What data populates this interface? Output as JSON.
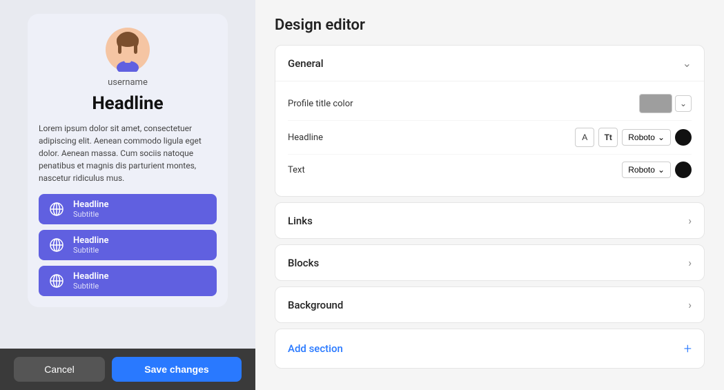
{
  "leftPanel": {
    "username": "username",
    "headline": "Headline",
    "bodyText": "Lorem ipsum dolor sit amet, consectetuer adipiscing elit. Aenean commodo ligula eget dolor. Aenean massa. Cum sociis natoque penatibus et magnis dis parturient montes, nascetur ridiculus mus.",
    "links": [
      {
        "title": "Headline",
        "subtitle": "Subtitle"
      },
      {
        "title": "Headline",
        "subtitle": "Subtitle"
      },
      {
        "title": "Headline",
        "subtitle": "Subtitle"
      }
    ],
    "cancelLabel": "Cancel",
    "saveLabel": "Save changes"
  },
  "rightPanel": {
    "title": "Design editor",
    "sections": {
      "general": {
        "label": "General",
        "expanded": true,
        "rows": [
          {
            "label": "Profile title color",
            "type": "color-picker",
            "swatchColor": "#9e9e9e"
          },
          {
            "label": "Headline",
            "type": "font",
            "font": "Roboto"
          },
          {
            "label": "Text",
            "type": "font",
            "font": "Roboto"
          }
        ]
      },
      "links": {
        "label": "Links",
        "expanded": false
      },
      "blocks": {
        "label": "Blocks",
        "expanded": false
      },
      "background": {
        "label": "Background",
        "expanded": false
      }
    },
    "addSection": "Add section"
  },
  "icons": {
    "chevronDown": "&#8964;",
    "chevronRight": "›",
    "globe": "⊕",
    "plus": "+"
  }
}
